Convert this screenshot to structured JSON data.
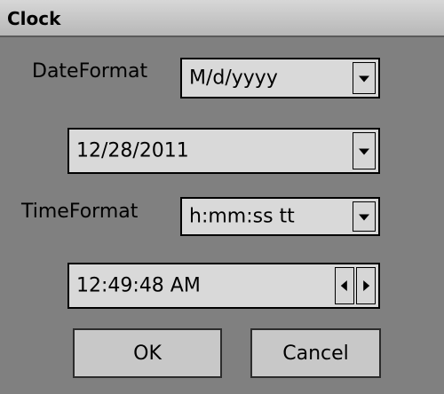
{
  "window": {
    "title": "Clock"
  },
  "date_format": {
    "label": "DateFormat",
    "value": "M/d/yyyy"
  },
  "date": {
    "value": "12/28/2011"
  },
  "time_format": {
    "label": "TimeFormat",
    "value": "h:mm:ss tt"
  },
  "time": {
    "value": "12:49:48 AM"
  },
  "buttons": {
    "ok": "OK",
    "cancel": "Cancel"
  },
  "icons": [
    "chevron-down-icon",
    "chevron-left-icon",
    "chevron-right-icon"
  ],
  "colors": {
    "background": "#808080",
    "control": "#d9d9d9",
    "titlebar": "#c8c8c8"
  }
}
